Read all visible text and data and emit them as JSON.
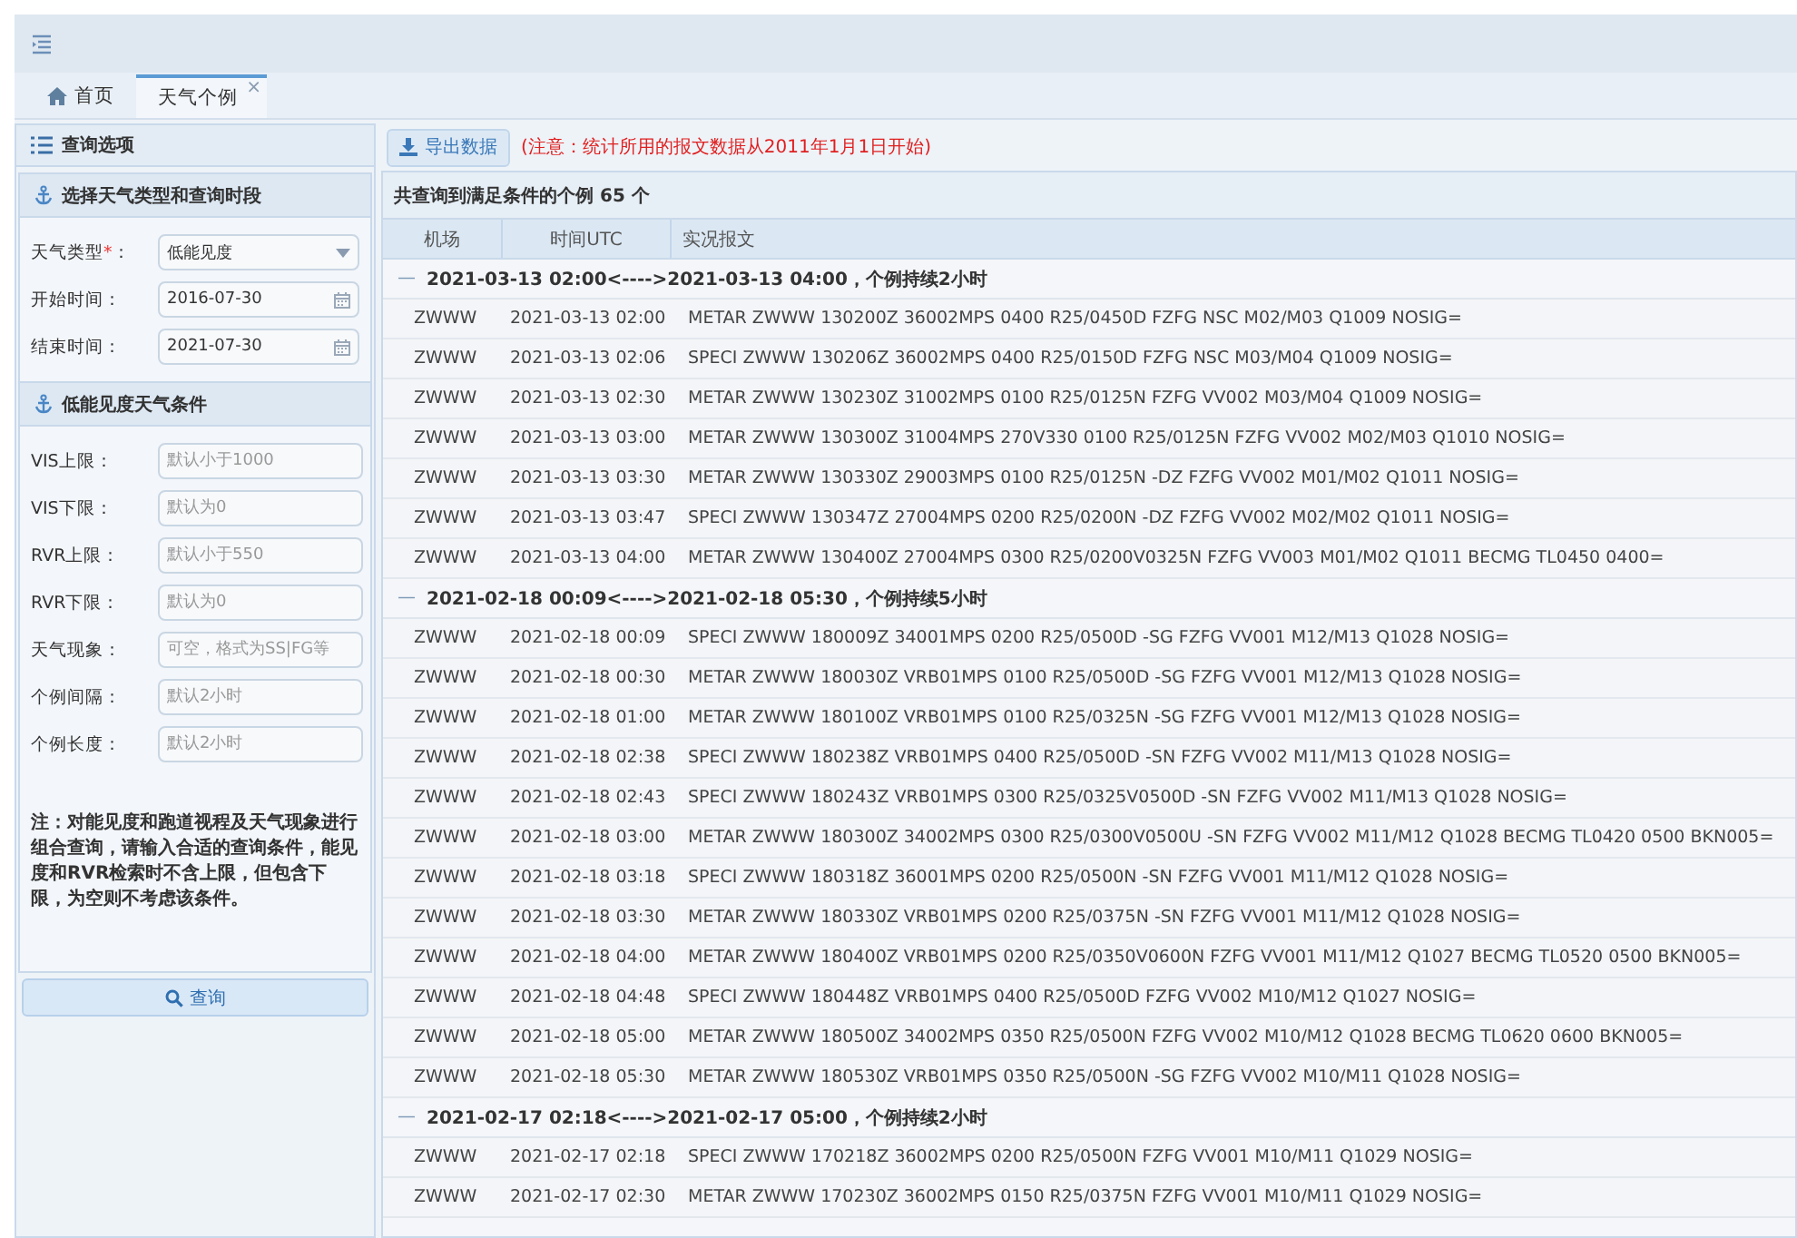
{
  "tabs": [
    {
      "label": "首页",
      "kind": "home",
      "selected": false
    },
    {
      "label": "天气个例",
      "kind": "closable",
      "selected": true,
      "close": "×"
    }
  ],
  "sidebar": {
    "title": "查询选项",
    "section1": {
      "title": "选择天气类型和查询时段",
      "fields": [
        {
          "label": "天气类型",
          "required_mark": "*",
          "suffix": "：",
          "kind": "select",
          "value": "低能见度"
        },
        {
          "label": "开始时间",
          "suffix": "：",
          "kind": "date",
          "value": "2016-07-30"
        },
        {
          "label": "结束时间",
          "suffix": "：",
          "kind": "date",
          "value": "2021-07-30"
        }
      ]
    },
    "section2": {
      "title": "低能见度天气条件",
      "fields": [
        {
          "label": "VIS上限：",
          "placeholder": "默认小于1000"
        },
        {
          "label": "VIS下限：",
          "placeholder": "默认为0"
        },
        {
          "label": "RVR上限：",
          "placeholder": "默认小于550"
        },
        {
          "label": "RVR下限：",
          "placeholder": "默认为0"
        },
        {
          "label": "天气现象：",
          "placeholder": "可空，格式为SS|FG等"
        },
        {
          "label": "个例间隔：",
          "placeholder": "默认2小时"
        },
        {
          "label": "个例长度：",
          "placeholder": "默认2小时"
        }
      ],
      "note": "注：对能见度和跑道视程及天气现象进行组合查询，请输入合适的查询条件，能见度和RVR检索时不含上限，但包含下限，为空则不考虑该条件。"
    },
    "query_button": "查询"
  },
  "toolbar": {
    "export_button": "导出数据",
    "notice": "(注意：统计所用的报文数据从2011年1月1日开始)"
  },
  "table": {
    "summary": "共查询到满足条件的个例 65 个",
    "columns": [
      "机场",
      "时间UTC",
      "实况报文"
    ],
    "groups": [
      {
        "title": "2021-03-13 02:00<---->2021-03-13 04:00，个例持续2小时",
        "expanded": true,
        "toggle": "—",
        "rows": [
          [
            "ZWWW",
            "2021-03-13 02:00",
            "METAR ZWWW 130200Z 36002MPS 0400 R25/0450D FZFG NSC M02/M03 Q1009 NOSIG="
          ],
          [
            "ZWWW",
            "2021-03-13 02:06",
            "SPECI ZWWW 130206Z 36002MPS 0400 R25/0150D FZFG NSC M03/M04 Q1009 NOSIG="
          ],
          [
            "ZWWW",
            "2021-03-13 02:30",
            "METAR ZWWW 130230Z 31002MPS 0100 R25/0125N FZFG VV002 M03/M04 Q1009 NOSIG="
          ],
          [
            "ZWWW",
            "2021-03-13 03:00",
            "METAR ZWWW 130300Z 31004MPS 270V330 0100 R25/0125N FZFG VV002 M02/M03 Q1010 NOSIG="
          ],
          [
            "ZWWW",
            "2021-03-13 03:30",
            "METAR ZWWW 130330Z 29003MPS 0100 R25/0125N -DZ FZFG VV002 M01/M02 Q1011 NOSIG="
          ],
          [
            "ZWWW",
            "2021-03-13 03:47",
            "SPECI ZWWW 130347Z 27004MPS 0200 R25/0200N -DZ FZFG VV002 M02/M02 Q1011 NOSIG="
          ],
          [
            "ZWWW",
            "2021-03-13 04:00",
            "METAR ZWWW 130400Z 27004MPS 0300 R25/0200V0325N FZFG VV003 M01/M02 Q1011 BECMG TL0450 0400="
          ]
        ]
      },
      {
        "title": "2021-02-18 00:09<---->2021-02-18 05:30，个例持续5小时",
        "expanded": true,
        "toggle": "—",
        "rows": [
          [
            "ZWWW",
            "2021-02-18 00:09",
            "SPECI ZWWW 180009Z 34001MPS 0200 R25/0500D -SG FZFG VV001 M12/M13 Q1028 NOSIG="
          ],
          [
            "ZWWW",
            "2021-02-18 00:30",
            "METAR ZWWW 180030Z VRB01MPS 0100 R25/0500D -SG FZFG VV001 M12/M13 Q1028 NOSIG="
          ],
          [
            "ZWWW",
            "2021-02-18 01:00",
            "METAR ZWWW 180100Z VRB01MPS 0100 R25/0325N -SG FZFG VV001 M12/M13 Q1028 NOSIG="
          ],
          [
            "ZWWW",
            "2021-02-18 02:38",
            "SPECI ZWWW 180238Z VRB01MPS 0400 R25/0500D -SN FZFG VV002 M11/M13 Q1028 NOSIG="
          ],
          [
            "ZWWW",
            "2021-02-18 02:43",
            "SPECI ZWWW 180243Z VRB01MPS 0300 R25/0325V0500D -SN FZFG VV002 M11/M13 Q1028 NOSIG="
          ],
          [
            "ZWWW",
            "2021-02-18 03:00",
            "METAR ZWWW 180300Z 34002MPS 0300 R25/0300V0500U -SN FZFG VV002 M11/M12 Q1028 BECMG TL0420 0500 BKN005="
          ],
          [
            "ZWWW",
            "2021-02-18 03:18",
            "SPECI ZWWW 180318Z 36001MPS 0200 R25/0500N -SN FZFG VV001 M11/M12 Q1028 NOSIG="
          ],
          [
            "ZWWW",
            "2021-02-18 03:30",
            "METAR ZWWW 180330Z VRB01MPS 0200 R25/0375N -SN FZFG VV001 M11/M12 Q1028 NOSIG="
          ],
          [
            "ZWWW",
            "2021-02-18 04:00",
            "METAR ZWWW 180400Z VRB01MPS 0200 R25/0350V0600N FZFG VV001 M11/M12 Q1027 BECMG TL0520 0500 BKN005="
          ],
          [
            "ZWWW",
            "2021-02-18 04:48",
            "SPECI ZWWW 180448Z VRB01MPS 0400 R25/0500D FZFG VV002 M10/M12 Q1027 NOSIG="
          ],
          [
            "ZWWW",
            "2021-02-18 05:00",
            "METAR ZWWW 180500Z 34002MPS 0350 R25/0500N FZFG VV002 M10/M12 Q1028 BECMG TL0620 0600 BKN005="
          ],
          [
            "ZWWW",
            "2021-02-18 05:30",
            "METAR ZWWW 180530Z VRB01MPS 0350 R25/0500N -SG FZFG VV002 M10/M11 Q1028 NOSIG="
          ]
        ]
      },
      {
        "title": "2021-02-17 02:18<---->2021-02-17 05:00，个例持续2小时",
        "expanded": true,
        "toggle": "—",
        "rows": [
          [
            "ZWWW",
            "2021-02-17 02:18",
            "SPECI ZWWW 170218Z 36002MPS 0200 R25/0500N FZFG VV001 M10/M11 Q1029 NOSIG="
          ],
          [
            "ZWWW",
            "2021-02-17 02:30",
            "METAR ZWWW 170230Z 36002MPS 0150 R25/0375N FZFG VV001 M10/M11 Q1029 NOSIG="
          ]
        ]
      }
    ]
  }
}
